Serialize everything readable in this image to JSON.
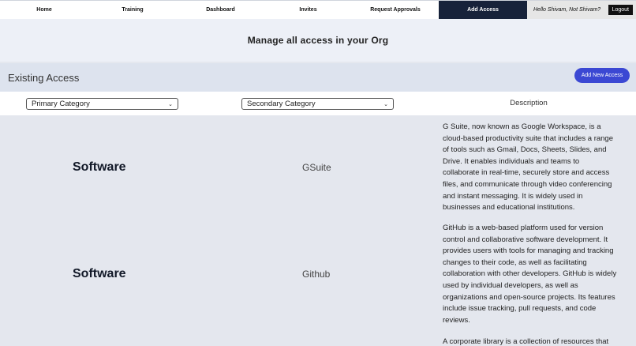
{
  "nav": {
    "items": [
      {
        "label": "Home"
      },
      {
        "label": "Training"
      },
      {
        "label": "Dashboard"
      },
      {
        "label": "Invites"
      },
      {
        "label": "Request Approvals"
      },
      {
        "label": "Add Access",
        "active": true
      }
    ],
    "user_greeting": "Hello Shivam, Not Shivam?",
    "logout_label": "Logout"
  },
  "page_title": "Manage all access in your Org",
  "existing": {
    "title": "Existing Access",
    "add_button_label": "Add New Access"
  },
  "filters": {
    "primary_placeholder": "Primary Category",
    "secondary_placeholder": "Secondary Category",
    "description_header": "Description"
  },
  "rows": [
    {
      "primary": "Software",
      "secondary": "GSuite",
      "description": "G Suite, now known as Google Workspace, is a cloud-based productivity suite that includes a range of tools such as Gmail, Docs, Sheets, Slides, and Drive. It enables individuals and teams to collaborate in real-time, securely store and access files, and communicate through video conferencing and instant messaging. It is widely used in businesses and educational institutions."
    },
    {
      "primary": "Software",
      "secondary": "Github",
      "description": "GitHub is a web-based platform used for version control and collaborative software development. It provides users with tools for managing and tracking changes to their code, as well as facilitating collaboration with other developers. GitHub is widely used by individual developers, as well as organizations and open-source projects. Its features include issue tracking, pull requests, and code reviews."
    },
    {
      "primary": "",
      "secondary": "",
      "description": "A corporate library is a collection of resources that"
    }
  ],
  "colors": {
    "nav_active_bg": "#17223a",
    "add_button_bg": "#3b48d3"
  }
}
